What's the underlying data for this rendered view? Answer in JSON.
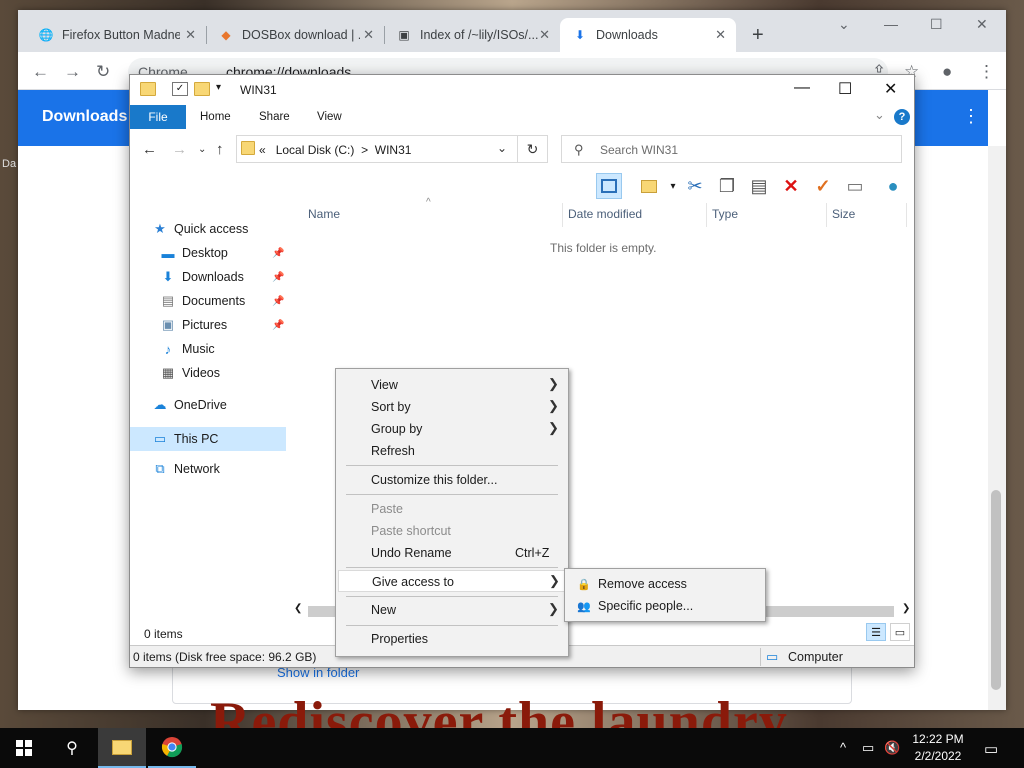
{
  "chrome": {
    "tabs": [
      {
        "title": "Firefox Button Madness",
        "icon": "globe-icon"
      },
      {
        "title": "DOSBox download | ...",
        "icon": "dosbox-icon"
      },
      {
        "title": "Index of /~lily/ISOs/...",
        "icon": "server-icon"
      },
      {
        "title": "Downloads",
        "icon": "download-icon"
      }
    ],
    "new_tab": "+",
    "url_chip": "Chrome",
    "url": "chrome://downloads",
    "page_title": "Downloads",
    "show_in_folder": "Show in folder",
    "side_fragment": "Da",
    "banner": "Rediscover the laundry"
  },
  "explorer": {
    "title": "WIN31",
    "ribbon_tabs": [
      "File",
      "Home",
      "Share",
      "View"
    ],
    "address": {
      "overflow": "«",
      "crumbs": [
        "Local Disk (C:)",
        "WIN31"
      ],
      "separator": ">"
    },
    "search_placeholder": "Search WIN31",
    "nav": {
      "quick_access": "Quick access",
      "items": [
        {
          "label": "Desktop",
          "icon": "desktop-icon",
          "pinned": true
        },
        {
          "label": "Downloads",
          "icon": "downloads-icon",
          "pinned": true
        },
        {
          "label": "Documents",
          "icon": "documents-icon",
          "pinned": true
        },
        {
          "label": "Pictures",
          "icon": "pictures-icon",
          "pinned": true
        },
        {
          "label": "Music",
          "icon": "music-icon",
          "pinned": false
        },
        {
          "label": "Videos",
          "icon": "videos-icon",
          "pinned": false
        }
      ],
      "onedrive": "OneDrive",
      "this_pc": "This PC",
      "network": "Network"
    },
    "columns": [
      "Name",
      "Date modified",
      "Type",
      "Size"
    ],
    "empty_message": "This folder is empty.",
    "item_count": "0 items",
    "disk_status": "0 items (Disk free space: 96.2 GB)",
    "location": "Computer"
  },
  "context_menu": {
    "items": [
      {
        "label": "View",
        "submenu": true
      },
      {
        "label": "Sort by",
        "submenu": true
      },
      {
        "label": "Group by",
        "submenu": true
      },
      {
        "label": "Refresh"
      },
      {
        "label": "Customize this folder..."
      },
      {
        "label": "Paste",
        "disabled": true
      },
      {
        "label": "Paste shortcut",
        "disabled": true
      },
      {
        "label": "Undo Rename",
        "shortcut": "Ctrl+Z"
      },
      {
        "label": "Give access to",
        "submenu": true,
        "highlighted": true
      },
      {
        "label": "New",
        "submenu": true
      },
      {
        "label": "Properties"
      }
    ],
    "submenu": [
      {
        "label": "Remove access",
        "icon": "lock-icon"
      },
      {
        "label": "Specific people...",
        "icon": "people-icon"
      }
    ]
  },
  "taskbar": {
    "time": "12:22 PM",
    "date": "2/2/2022"
  },
  "colors": {
    "chrome_blue": "#1a73e8",
    "file_tab": "#1979ca",
    "selection": "#cce8ff"
  }
}
